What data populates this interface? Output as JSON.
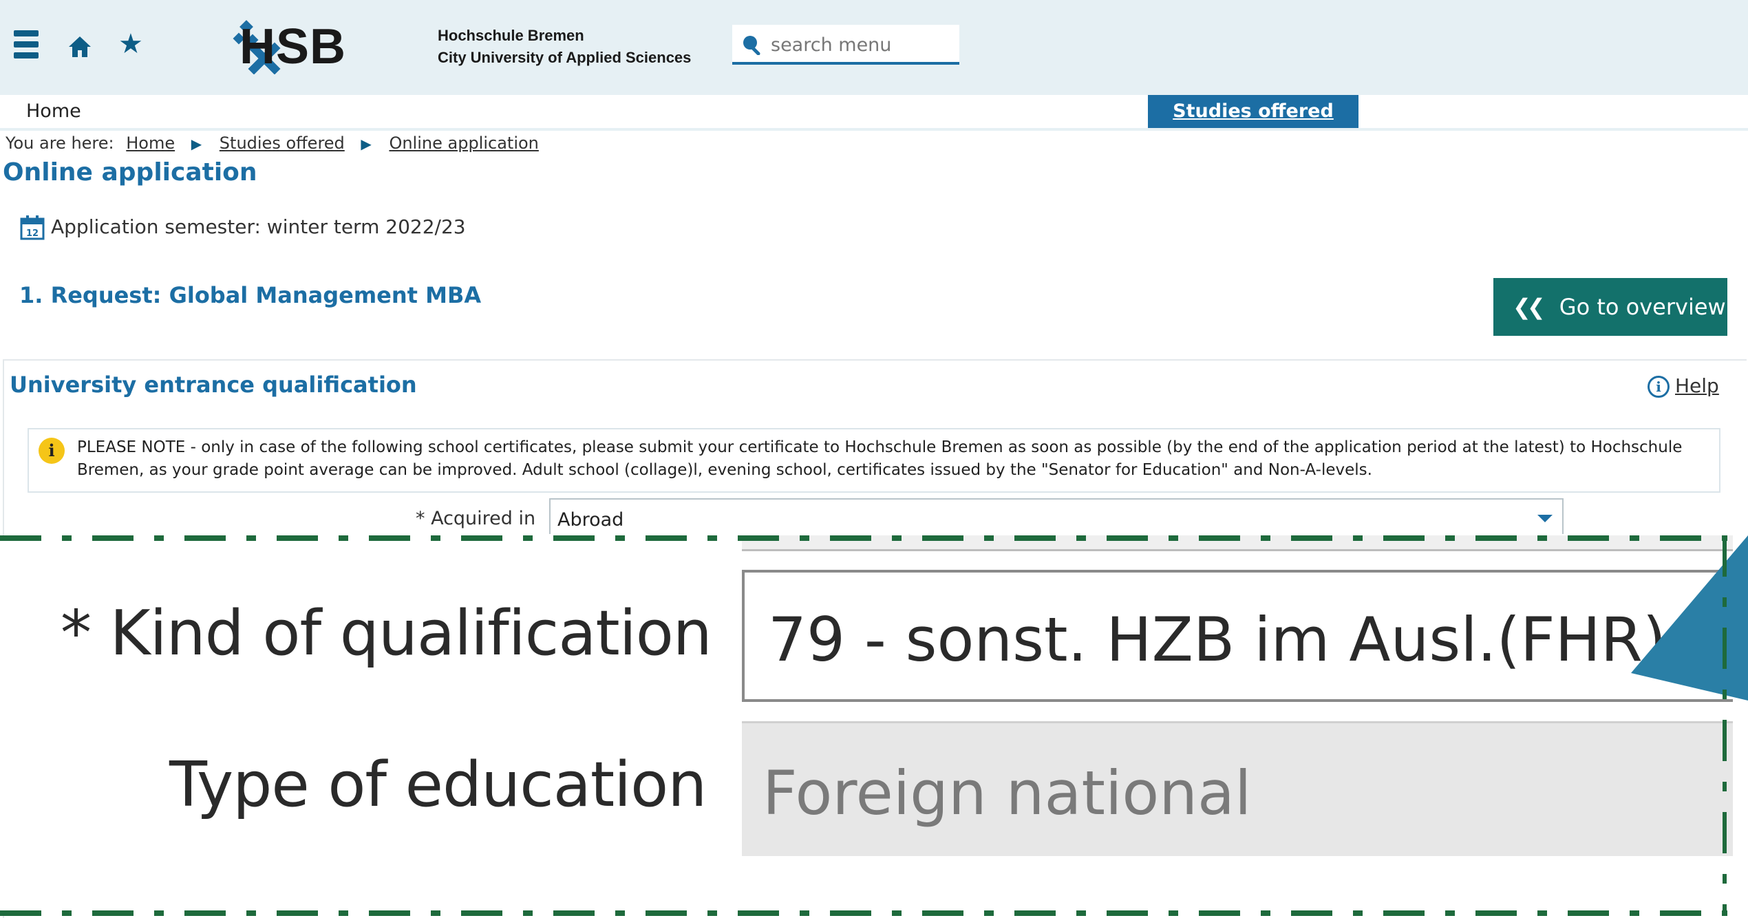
{
  "header": {
    "logo_text": "HSB",
    "university_line1": "Hochschule Bremen",
    "university_line2": "City University of Applied Sciences",
    "search_placeholder": "search menu"
  },
  "nav": {
    "home": "Home",
    "studies_offered": "Studies offered"
  },
  "breadcrumb": {
    "prefix": "You are here:",
    "items": [
      "Home",
      "Studies offered",
      "Online application"
    ]
  },
  "page": {
    "title": "Online application",
    "semester": "Application semester: winter term 2022/23",
    "calendar_day": "12",
    "request_title": "1. Request: Global Management MBA",
    "overview_button": "Go to overview"
  },
  "section": {
    "title": "University entrance qualification",
    "help": "Help",
    "note": "PLEASE NOTE - only in case of the following school certificates, please submit your certificate to Hochschule Bremen as soon as possible (by the end of the application period at the latest) to Hochschule Bremen, as your grade point average can be improved. Adult school (collage)l, evening school, certificates issued by the \"Senator for Education\" and Non-A-levels.",
    "acquired_in_label": "* Acquired in",
    "acquired_in_value": "Abroad"
  },
  "zoom": {
    "kind_label": "* Kind of qualification",
    "kind_value": "79 - sonst. HZB im Ausl.(FHR)",
    "type_label": "Type of education",
    "type_value": "Foreign national"
  },
  "colors": {
    "header_bg": "#e6f0f4",
    "brand_blue": "#1c6ea4",
    "button_teal": "#13716b",
    "dash_green": "#1e6a3c",
    "callout_blue": "#2a7fa6"
  }
}
